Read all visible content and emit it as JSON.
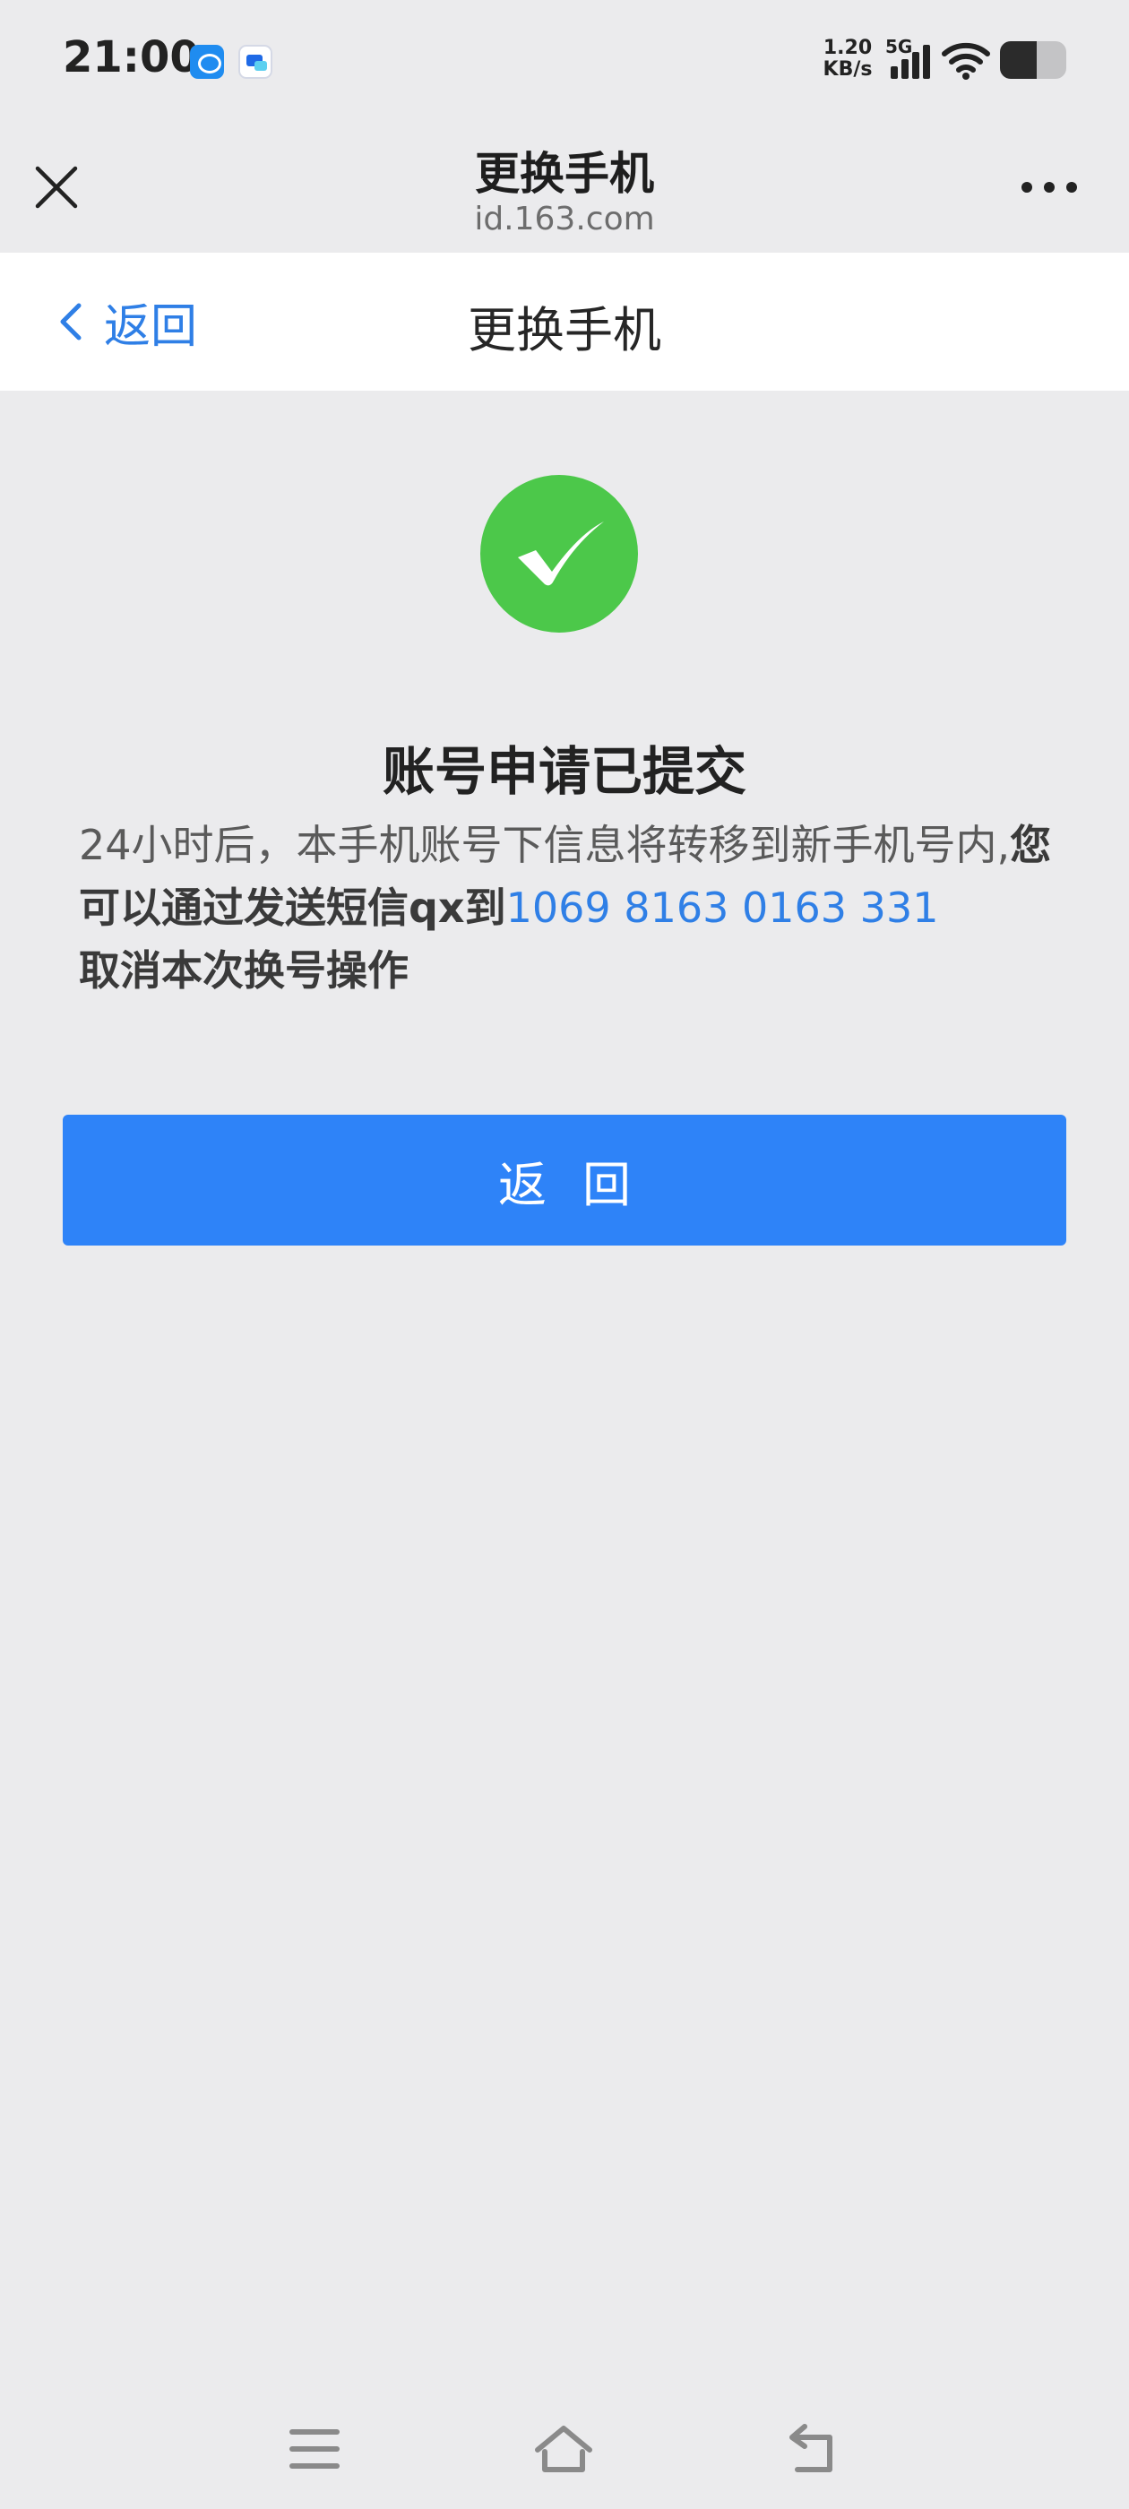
{
  "status_bar": {
    "time": "21:00",
    "net_speed_value": "1.20",
    "net_speed_unit": "KB/s",
    "network_type": "5G",
    "battery_level": 0.55,
    "icons": [
      "baidu-app-icon",
      "message-app-icon",
      "signal-icon",
      "wifi-icon",
      "battery-icon"
    ]
  },
  "browser": {
    "title": "更换手机",
    "url": "id.163.com",
    "icons": [
      "close-icon",
      "more-icon"
    ]
  },
  "nav": {
    "back_label": "返回",
    "title": "更换手机",
    "icons": [
      "chevron-left-icon"
    ]
  },
  "result": {
    "icon": "check-circle-icon",
    "title": "账号申请已提交",
    "message_part1": "24小时后，本手机账号下信息将转移到新手机号内,",
    "message_bold1": "您可以通过发送短信qx到",
    "message_phone": "1069 8163 0163 331",
    "message_bold2": "取消本次换号操作"
  },
  "button": {
    "label": "返回"
  },
  "system_nav": {
    "icons": [
      "menu-icon",
      "home-icon",
      "back-icon"
    ]
  },
  "colors": {
    "accent": "#2e83f8",
    "link": "#2f7fe6",
    "success": "#4cc84a",
    "background": "#ebebed"
  }
}
